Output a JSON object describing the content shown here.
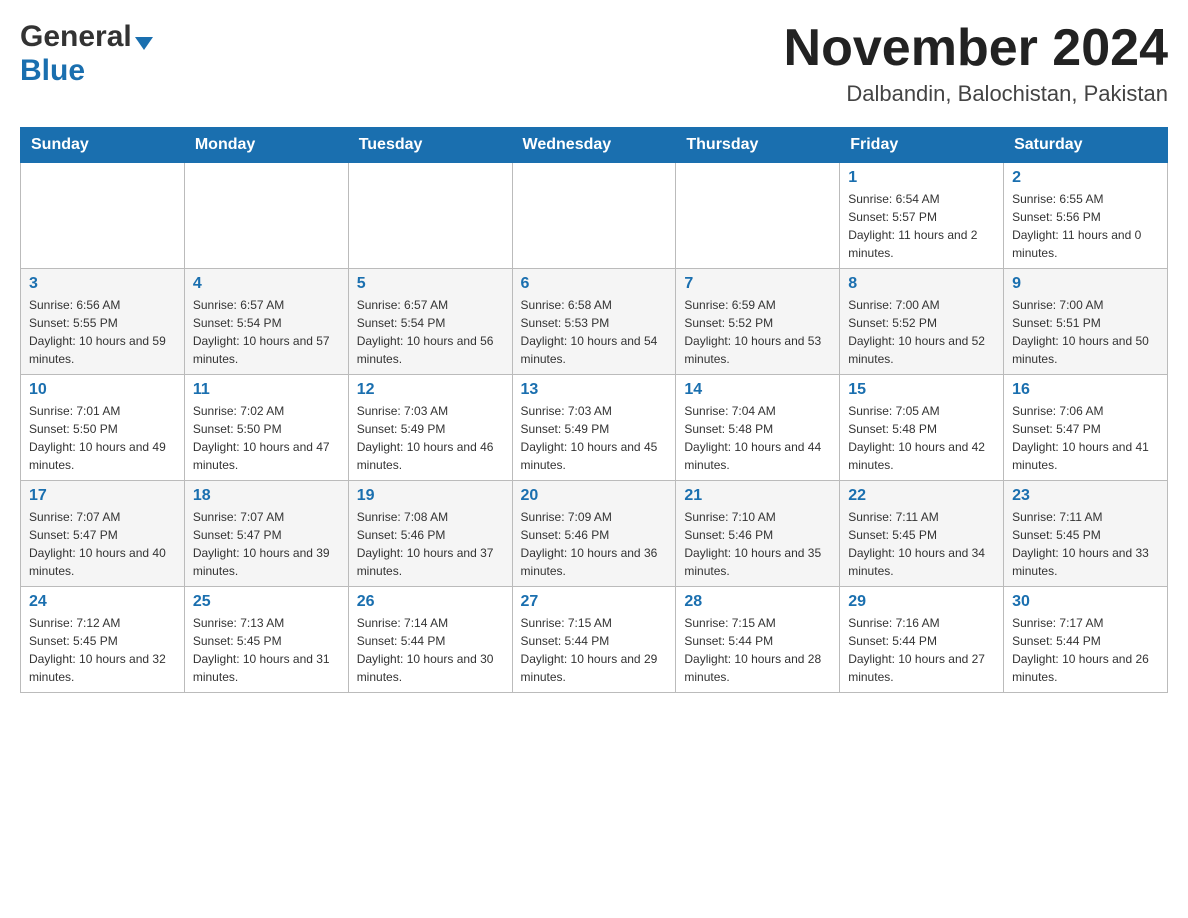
{
  "logo": {
    "general": "General",
    "blue": "Blue"
  },
  "header": {
    "month": "November 2024",
    "location": "Dalbandin, Balochistan, Pakistan"
  },
  "weekdays": [
    "Sunday",
    "Monday",
    "Tuesday",
    "Wednesday",
    "Thursday",
    "Friday",
    "Saturday"
  ],
  "weeks": [
    {
      "days": [
        {
          "number": "",
          "info": ""
        },
        {
          "number": "",
          "info": ""
        },
        {
          "number": "",
          "info": ""
        },
        {
          "number": "",
          "info": ""
        },
        {
          "number": "",
          "info": ""
        },
        {
          "number": "1",
          "info": "Sunrise: 6:54 AM\nSunset: 5:57 PM\nDaylight: 11 hours and 2 minutes."
        },
        {
          "number": "2",
          "info": "Sunrise: 6:55 AM\nSunset: 5:56 PM\nDaylight: 11 hours and 0 minutes."
        }
      ]
    },
    {
      "days": [
        {
          "number": "3",
          "info": "Sunrise: 6:56 AM\nSunset: 5:55 PM\nDaylight: 10 hours and 59 minutes."
        },
        {
          "number": "4",
          "info": "Sunrise: 6:57 AM\nSunset: 5:54 PM\nDaylight: 10 hours and 57 minutes."
        },
        {
          "number": "5",
          "info": "Sunrise: 6:57 AM\nSunset: 5:54 PM\nDaylight: 10 hours and 56 minutes."
        },
        {
          "number": "6",
          "info": "Sunrise: 6:58 AM\nSunset: 5:53 PM\nDaylight: 10 hours and 54 minutes."
        },
        {
          "number": "7",
          "info": "Sunrise: 6:59 AM\nSunset: 5:52 PM\nDaylight: 10 hours and 53 minutes."
        },
        {
          "number": "8",
          "info": "Sunrise: 7:00 AM\nSunset: 5:52 PM\nDaylight: 10 hours and 52 minutes."
        },
        {
          "number": "9",
          "info": "Sunrise: 7:00 AM\nSunset: 5:51 PM\nDaylight: 10 hours and 50 minutes."
        }
      ]
    },
    {
      "days": [
        {
          "number": "10",
          "info": "Sunrise: 7:01 AM\nSunset: 5:50 PM\nDaylight: 10 hours and 49 minutes."
        },
        {
          "number": "11",
          "info": "Sunrise: 7:02 AM\nSunset: 5:50 PM\nDaylight: 10 hours and 47 minutes."
        },
        {
          "number": "12",
          "info": "Sunrise: 7:03 AM\nSunset: 5:49 PM\nDaylight: 10 hours and 46 minutes."
        },
        {
          "number": "13",
          "info": "Sunrise: 7:03 AM\nSunset: 5:49 PM\nDaylight: 10 hours and 45 minutes."
        },
        {
          "number": "14",
          "info": "Sunrise: 7:04 AM\nSunset: 5:48 PM\nDaylight: 10 hours and 44 minutes."
        },
        {
          "number": "15",
          "info": "Sunrise: 7:05 AM\nSunset: 5:48 PM\nDaylight: 10 hours and 42 minutes."
        },
        {
          "number": "16",
          "info": "Sunrise: 7:06 AM\nSunset: 5:47 PM\nDaylight: 10 hours and 41 minutes."
        }
      ]
    },
    {
      "days": [
        {
          "number": "17",
          "info": "Sunrise: 7:07 AM\nSunset: 5:47 PM\nDaylight: 10 hours and 40 minutes."
        },
        {
          "number": "18",
          "info": "Sunrise: 7:07 AM\nSunset: 5:47 PM\nDaylight: 10 hours and 39 minutes."
        },
        {
          "number": "19",
          "info": "Sunrise: 7:08 AM\nSunset: 5:46 PM\nDaylight: 10 hours and 37 minutes."
        },
        {
          "number": "20",
          "info": "Sunrise: 7:09 AM\nSunset: 5:46 PM\nDaylight: 10 hours and 36 minutes."
        },
        {
          "number": "21",
          "info": "Sunrise: 7:10 AM\nSunset: 5:46 PM\nDaylight: 10 hours and 35 minutes."
        },
        {
          "number": "22",
          "info": "Sunrise: 7:11 AM\nSunset: 5:45 PM\nDaylight: 10 hours and 34 minutes."
        },
        {
          "number": "23",
          "info": "Sunrise: 7:11 AM\nSunset: 5:45 PM\nDaylight: 10 hours and 33 minutes."
        }
      ]
    },
    {
      "days": [
        {
          "number": "24",
          "info": "Sunrise: 7:12 AM\nSunset: 5:45 PM\nDaylight: 10 hours and 32 minutes."
        },
        {
          "number": "25",
          "info": "Sunrise: 7:13 AM\nSunset: 5:45 PM\nDaylight: 10 hours and 31 minutes."
        },
        {
          "number": "26",
          "info": "Sunrise: 7:14 AM\nSunset: 5:44 PM\nDaylight: 10 hours and 30 minutes."
        },
        {
          "number": "27",
          "info": "Sunrise: 7:15 AM\nSunset: 5:44 PM\nDaylight: 10 hours and 29 minutes."
        },
        {
          "number": "28",
          "info": "Sunrise: 7:15 AM\nSunset: 5:44 PM\nDaylight: 10 hours and 28 minutes."
        },
        {
          "number": "29",
          "info": "Sunrise: 7:16 AM\nSunset: 5:44 PM\nDaylight: 10 hours and 27 minutes."
        },
        {
          "number": "30",
          "info": "Sunrise: 7:17 AM\nSunset: 5:44 PM\nDaylight: 10 hours and 26 minutes."
        }
      ]
    }
  ]
}
